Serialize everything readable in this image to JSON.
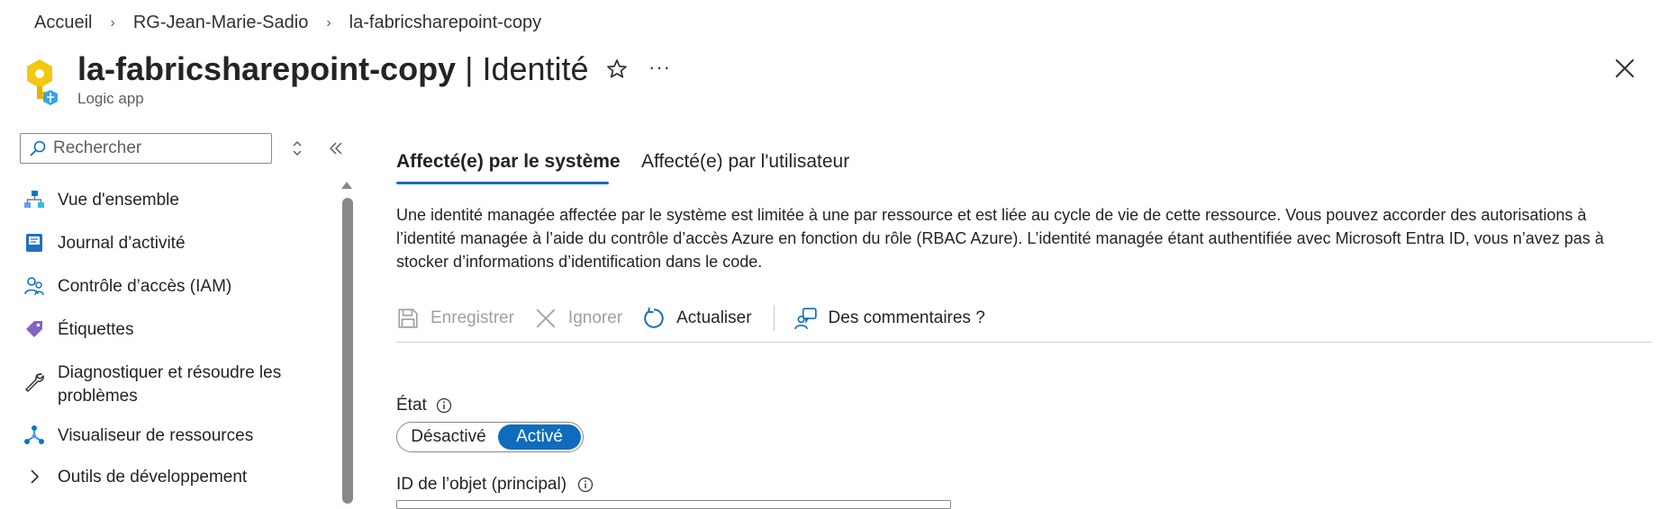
{
  "breadcrumb": {
    "items": [
      "Accueil",
      "RG-Jean-Marie-Sadio",
      "la-fabricsharepoint-copy"
    ],
    "separator": "›"
  },
  "header": {
    "resource_name": "la-fabricsharepoint-copy",
    "title_separator": " | ",
    "blade_name": "Identité",
    "subtitle": "Logic app",
    "more": "···"
  },
  "sidebar": {
    "search_placeholder": "Rechercher",
    "items": [
      {
        "label": "Vue d'ensemble",
        "icon": "overview-icon"
      },
      {
        "label": "Journal d’activité",
        "icon": "activity-log-icon"
      },
      {
        "label": "Contrôle d’accès (IAM)",
        "icon": "iam-icon"
      },
      {
        "label": "Étiquettes",
        "icon": "tag-icon"
      },
      {
        "label": "Diagnostiquer et résoudre les problèmes",
        "icon": "wrench-icon"
      },
      {
        "label": "Visualiseur de ressources",
        "icon": "resource-visualizer-icon"
      },
      {
        "label": "Outils de développement",
        "icon": "chevron-right-icon"
      }
    ]
  },
  "tabs": [
    {
      "label": "Affecté(e) par le système",
      "selected": true
    },
    {
      "label": "Affecté(e) par l'utilisateur",
      "selected": false
    }
  ],
  "description": "Une identité managée affectée par le système est limitée à une par ressource et est liée au cycle de vie de cette ressource. Vous pouvez accorder des autorisations à l’identité managée à l’aide du contrôle d’accès Azure en fonction du rôle (RBAC Azure). L’identité managée étant authentifiée avec Microsoft Entra ID, vous n’avez pas à stocker d’informations d’identification dans le code.",
  "toolbar": {
    "save": "Enregistrer",
    "discard": "Ignorer",
    "refresh": "Actualiser",
    "feedback": "Des commentaires ?"
  },
  "form": {
    "state_label": "État",
    "state_off": "Désactivé",
    "state_on": "Activé",
    "state_value": "Activé",
    "object_id_label": "ID de l’objet (principal)"
  },
  "colors": {
    "accent": "#0f6cbd",
    "text": "#242424",
    "muted": "#605e5c",
    "disabled": "#a19f9d"
  }
}
